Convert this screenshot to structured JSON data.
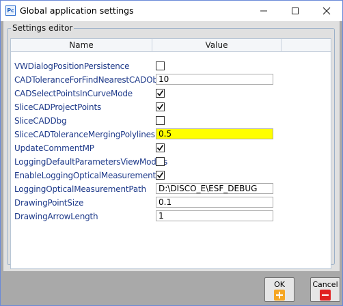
{
  "window": {
    "title": "Global application settings",
    "app_icon_text": "Pc",
    "controls": {
      "minimize": "minimize-icon",
      "maximize": "maximize-icon",
      "close": "close-icon"
    }
  },
  "settings_group": {
    "legend": "Settings editor",
    "columns": {
      "name": "Name",
      "value": "Value"
    },
    "rows": [
      {
        "name": "VWDialogPositionPersistence",
        "type": "checkbox",
        "checked": false
      },
      {
        "name": "CADToleranceForFindNearestCADObject",
        "type": "text",
        "value": "10"
      },
      {
        "name": "CADSelectPointsInCurveMode",
        "type": "checkbox",
        "checked": true
      },
      {
        "name": "SliceCADProjectPoints",
        "type": "checkbox",
        "checked": true
      },
      {
        "name": "SliceCADDbg",
        "type": "checkbox",
        "checked": false
      },
      {
        "name": "SliceCADToleranceMergingPolylines",
        "type": "text",
        "value": "0.5",
        "highlight": "#ffff00"
      },
      {
        "name": "UpdateCommentMP",
        "type": "checkbox",
        "checked": true
      },
      {
        "name": "LoggingDefaultParametersViewModels",
        "type": "checkbox",
        "checked": false
      },
      {
        "name": "EnableLoggingOpticalMeasurement",
        "type": "checkbox",
        "checked": true
      },
      {
        "name": "LoggingOpticalMeasurementPath",
        "type": "text",
        "value": "D:\\DISCO_E\\ESF_DEBUG"
      },
      {
        "name": "DrawingPointSize",
        "type": "text",
        "value": "0.1"
      },
      {
        "name": "DrawingArrowLength",
        "type": "text",
        "value": "1"
      }
    ]
  },
  "buttons": {
    "ok": {
      "label": "OK",
      "icon": "plus-icon",
      "color": "#f5a623"
    },
    "cancel": {
      "label": "Cancel",
      "icon": "minus-icon",
      "color": "#e02020"
    }
  }
}
